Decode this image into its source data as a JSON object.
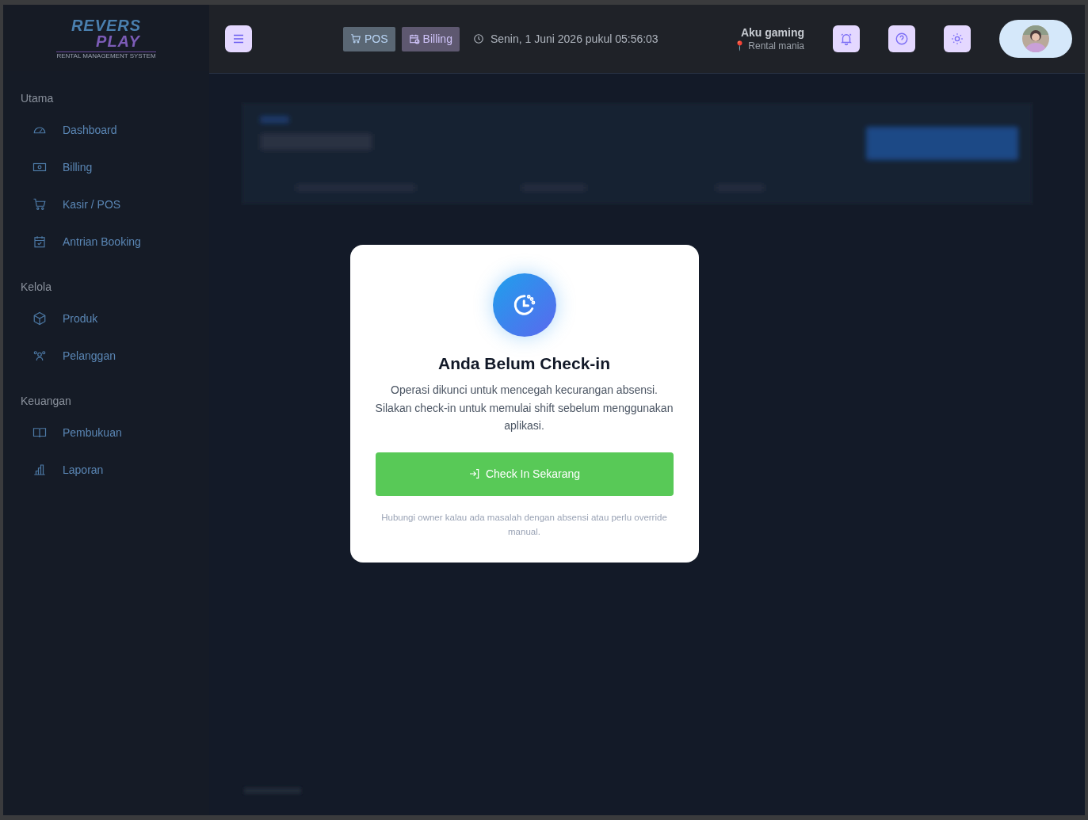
{
  "logo": {
    "title_line_1": "REVERS",
    "title_line_2": "PLAY",
    "tagline": "RENTAL MANAGEMENT SYSTEM"
  },
  "sidebar": {
    "sections": [
      {
        "label": "Utama",
        "items": [
          {
            "label": "Dashboard"
          },
          {
            "label": "Billing"
          },
          {
            "label": "Kasir / POS"
          },
          {
            "label": "Antrian Booking"
          }
        ]
      },
      {
        "label": "Kelola",
        "items": [
          {
            "label": "Produk"
          },
          {
            "label": "Pelanggan"
          }
        ]
      },
      {
        "label": "Keuangan",
        "items": [
          {
            "label": "Pembukuan"
          },
          {
            "label": "Laporan"
          }
        ]
      }
    ]
  },
  "header": {
    "quick_buttons": [
      {
        "label": "POS"
      },
      {
        "label": "Billing"
      }
    ],
    "datetime": "Senin, 1 Juni 2026 pukul 05:56:03",
    "user": {
      "name": "Aku gaming",
      "location": "📍 Rental mania"
    }
  },
  "modal": {
    "title": "Anda Belum Check-in",
    "message": "Operasi dikunci untuk mencegah kecurangan absensi. Silakan check-in untuk memulai shift sebelum menggunakan aplikasi.",
    "button": "Check In Sekarang",
    "note": "Hubungi owner kalau ada masalah dengan absensi atau perlu override manual."
  }
}
